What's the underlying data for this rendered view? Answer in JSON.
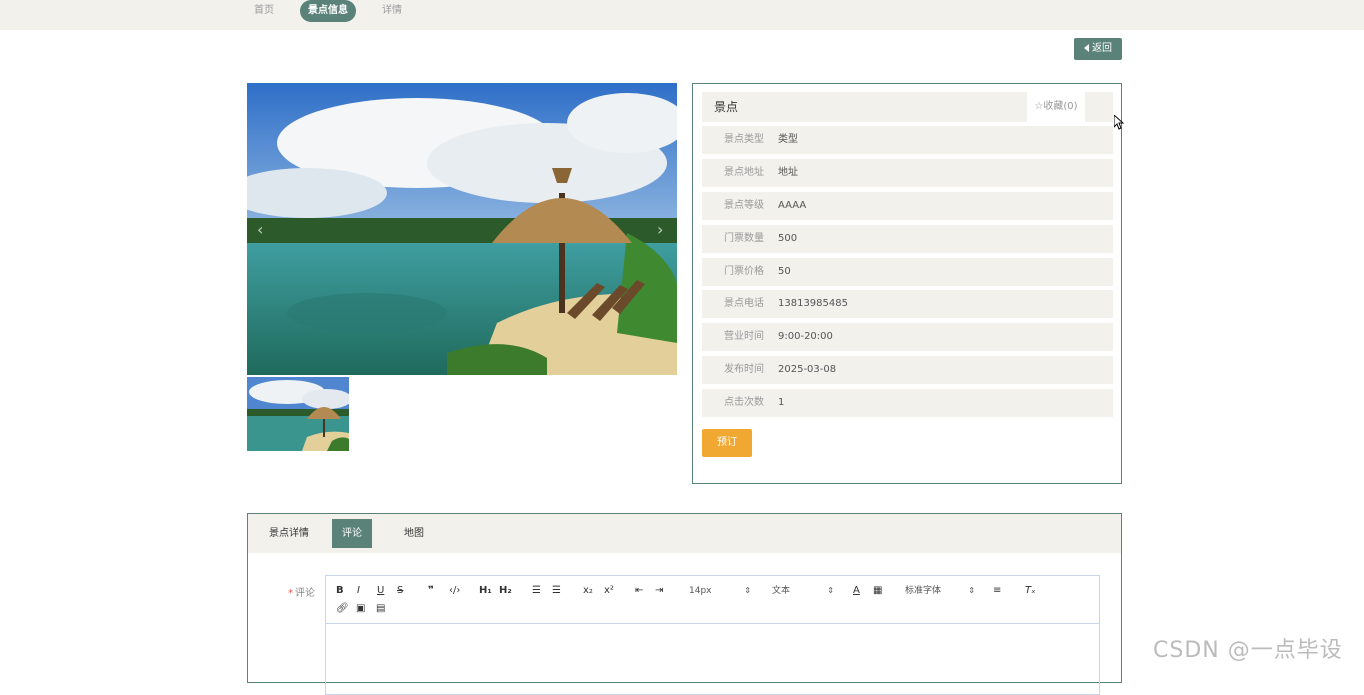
{
  "topbar": {
    "crumbs": [
      "首页",
      "景点信息",
      "详情"
    ]
  },
  "back_label": "返回",
  "gallery": {
    "prev_icon": "chevron-left-icon",
    "next_icon": "chevron-right-icon"
  },
  "info": {
    "title": "景点",
    "favorite": "☆收藏(0)",
    "rows": [
      {
        "key": "景点类型",
        "value": "类型"
      },
      {
        "key": "景点地址",
        "value": "地址"
      },
      {
        "key": "景点等级",
        "value": "AAAA"
      },
      {
        "key": "门票数量",
        "value": "500"
      },
      {
        "key": "门票价格",
        "value": "50"
      },
      {
        "key": "景点电话",
        "value": "13813985485"
      },
      {
        "key": "营业时间",
        "value": "9:00-20:00"
      },
      {
        "key": "发布时间",
        "value": "2025-03-08"
      },
      {
        "key": "点击次数",
        "value": "1"
      }
    ],
    "book_label": "预订"
  },
  "tabs": [
    "景点详情",
    "评论",
    "地图"
  ],
  "active_tab": "评论",
  "comment": {
    "required_mark": "*",
    "label": "评论",
    "font_size": "14px",
    "text_type": "文本",
    "font_family": "标准字体"
  },
  "colors": {
    "accent": "#5a8278",
    "panel": "#f2f1ec",
    "book": "#f0a833"
  },
  "watermark": "CSDN @一点毕设"
}
